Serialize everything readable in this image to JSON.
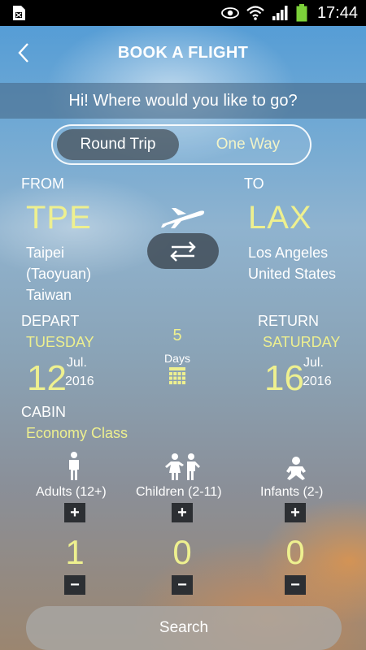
{
  "status_bar": {
    "time": "17:44"
  },
  "header": {
    "title": "BOOK A FLIGHT"
  },
  "greeting": "Hi! Where would you like to go?",
  "trip_type": {
    "options": [
      "Round Trip",
      "One Way"
    ],
    "selected": "Round Trip"
  },
  "from": {
    "label": "FROM",
    "code": "TPE",
    "city_line1": "Taipei",
    "city_line2": "(Taoyuan)",
    "country": "Taiwan"
  },
  "to": {
    "label": "TO",
    "code": "LAX",
    "city_line1": "Los Angeles",
    "country": "United States"
  },
  "depart": {
    "label": "DEPART",
    "weekday": "TUESDAY",
    "day": "12",
    "month": "Jul.",
    "year": "2016"
  },
  "return": {
    "label": "RETURN",
    "weekday": "SATURDAY",
    "day": "16",
    "month": "Jul.",
    "year": "2016"
  },
  "duration": {
    "count": "5",
    "unit": "Days"
  },
  "cabin": {
    "label": "CABIN",
    "value": "Economy Class"
  },
  "passengers": [
    {
      "label": "Adults (12+)",
      "count": "1",
      "plus": "+",
      "minus": "−"
    },
    {
      "label": "Children (2-11)",
      "count": "0",
      "plus": "+",
      "minus": "−"
    },
    {
      "label": "Infants (2-)",
      "count": "0",
      "plus": "+",
      "minus": "−"
    }
  ],
  "search_button": "Search",
  "colors": {
    "accent_yellow": "#eef08f",
    "status_bar": "#000000",
    "battery": "#7cd13a"
  }
}
